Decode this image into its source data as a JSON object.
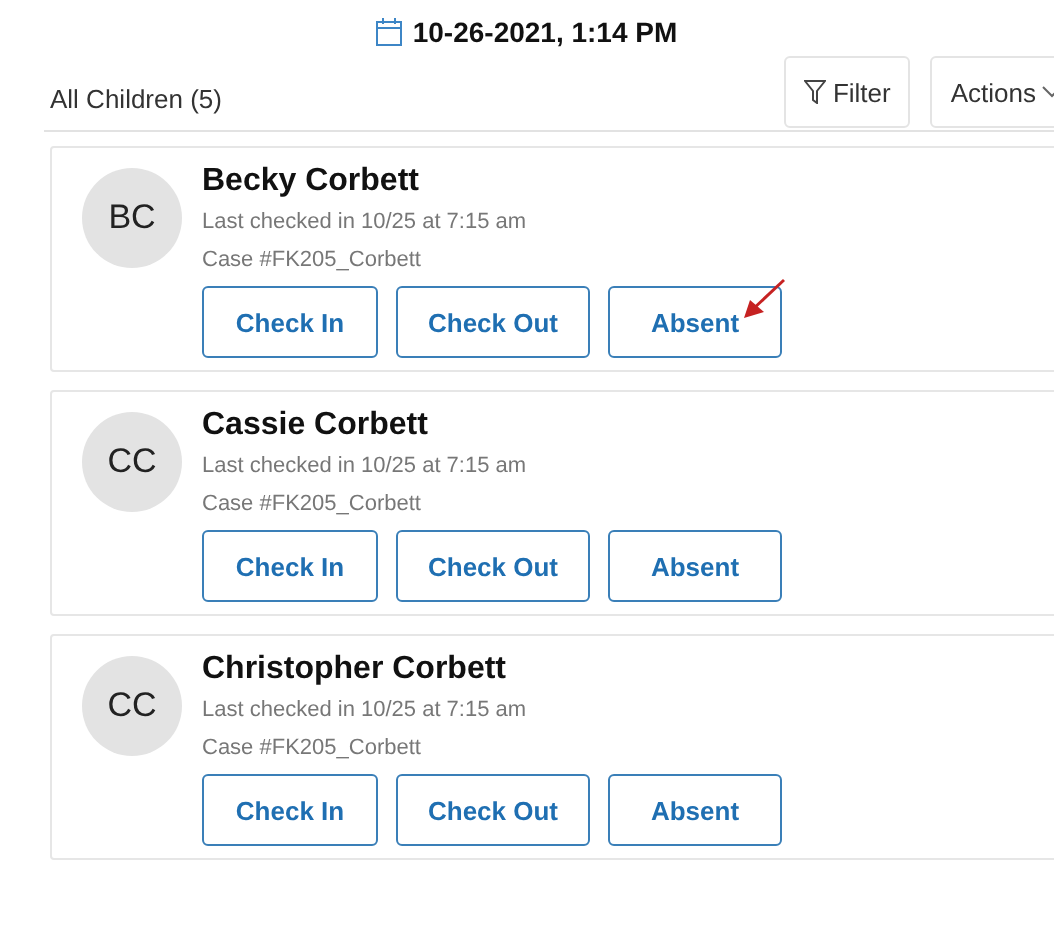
{
  "header": {
    "date": "10-26-2021, 1:14 PM"
  },
  "toolbar": {
    "title": "All Children (5)",
    "filter": "Filter",
    "actions": "Actions"
  },
  "children": [
    {
      "initials": "BC",
      "name": "Becky Corbett",
      "last_checked": "Last checked in 10/25 at 7:15 am",
      "case": "Case #FK205_Corbett",
      "buttons": [
        "Check In",
        "Check Out",
        "Absent"
      ],
      "marked": true
    },
    {
      "initials": "CC",
      "name": "Cassie Corbett",
      "last_checked": "Last checked in 10/25 at 7:15 am",
      "case": "Case #FK205_Corbett",
      "buttons": [
        "Check In",
        "Check Out",
        "Absent"
      ],
      "marked": false
    },
    {
      "initials": "CC",
      "name": "Christopher Corbett",
      "last_checked": "Last checked in 10/25 at 7:15 am",
      "case": "Case #FK205_Corbett",
      "buttons": [
        "Check In",
        "Check Out",
        "Absent"
      ],
      "marked": false
    }
  ]
}
